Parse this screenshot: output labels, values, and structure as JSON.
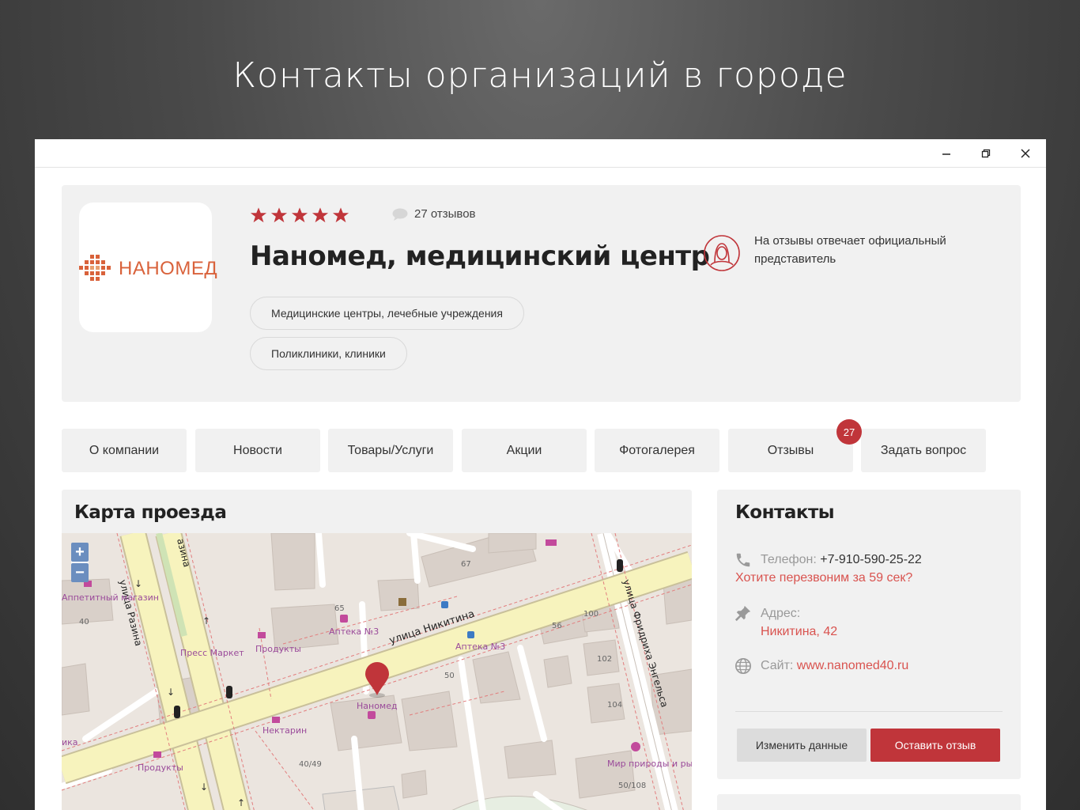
{
  "slide_title": "Контакты организаций в городе",
  "company": {
    "logo_text": "НАНОМЕД",
    "rating_stars": 5,
    "reviews_label": "27 отзывов",
    "name": "Наномед, медицинский центр",
    "tags": [
      "Медицинские центры, лечебные учреждения",
      "Поликлиники, клиники"
    ],
    "representative_note": "На отзывы отвечает официальный представитель"
  },
  "tabs": [
    {
      "label": "О компании"
    },
    {
      "label": "Новости"
    },
    {
      "label": "Товары/Услуги"
    },
    {
      "label": "Акции"
    },
    {
      "label": "Фотогалерея"
    },
    {
      "label": "Отзывы",
      "badge": "27"
    },
    {
      "label": "Задать вопрос"
    }
  ],
  "map": {
    "title": "Карта проезда",
    "zoom_in": "+",
    "zoom_out": "−",
    "labels": {
      "street_razina_1": "улица Разина",
      "street_razina_2": "азина",
      "street_nikitina": "улица Никитина",
      "street_engelsa": "улица Фридриха Энгельса",
      "appetit": "Аппетитный магазин",
      "appetit_num": "40",
      "press": "Пресс Маркет",
      "produkty1": "Продукты",
      "produkty2": "Продукты",
      "apteka1": "Аптека №3",
      "apteka1_num": "65",
      "apteka2": "Аптека №3",
      "nanomed": "Наномед",
      "nektarin": "Нектарин",
      "n67": "67",
      "n56": "56",
      "n100": "100",
      "n102": "102",
      "n104": "104",
      "n50": "50",
      "n4049": "40/49",
      "mir": "Мир природы и рыбалки",
      "mir_num": "50/108",
      "ika": "ика"
    }
  },
  "contacts": {
    "title": "Контакты",
    "phone_label": "Телефон:",
    "phone_value": "+7-910-590-25-22",
    "callback": "Хотите перезвоним за 59 сек?",
    "address_label": "Адрес:",
    "address_value": "Никитина, 42",
    "site_label": "Сайт:",
    "site_value": "www.nanomed40.ru",
    "btn_edit": "Изменить данные",
    "btn_review": "Оставить отзыв"
  },
  "colors": {
    "accent_red": "#c0353a",
    "link_red": "#d9534f",
    "logo_orange": "#d9623b",
    "card_bg": "#f1f1f1"
  }
}
